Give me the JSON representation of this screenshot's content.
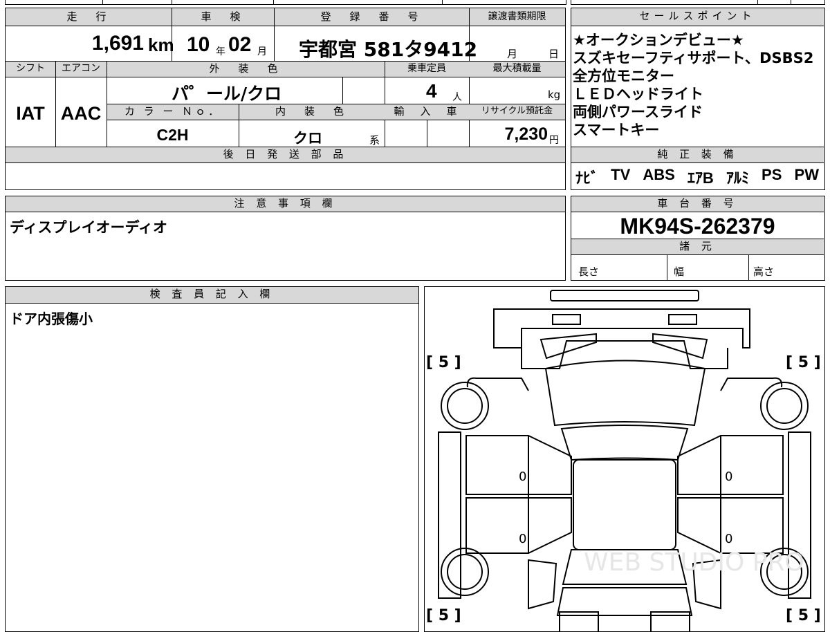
{
  "top_sheet": {
    "mileage": {
      "label": "走　行",
      "value": "1,691",
      "unit": "km"
    },
    "inspection": {
      "label": "車　検",
      "year": "10",
      "year_unit": "年",
      "month": "02",
      "month_unit": "月"
    },
    "registration": {
      "label": "登　録　番　号",
      "value": "宇都宮 581タ9412"
    },
    "transfer_deadline": {
      "label": "譲渡書類期限",
      "month_unit": "月",
      "day_unit": "日"
    },
    "shift": {
      "label": "シフト",
      "value": "IAT"
    },
    "aircon": {
      "label": "エアコン",
      "value": "AAC"
    },
    "exterior_color": {
      "label": "外　装　色",
      "value": "パ゜ール/クロ"
    },
    "capacity": {
      "label": "乗車定員",
      "value": "4",
      "unit": "人"
    },
    "max_load": {
      "label": "最大積載量",
      "unit": "kg"
    },
    "color_no": {
      "label": "カ ラ ー Ｎｏ．",
      "value": "C2H"
    },
    "interior_color": {
      "label": "内　装　色",
      "value": "クロ",
      "suffix": "系"
    },
    "import": {
      "label": "輸　入　車"
    },
    "recycle": {
      "label": "リサイクル預託金",
      "value": "7,230",
      "unit": "円"
    },
    "later_parts": {
      "label": "後 日 発 送 部 品"
    }
  },
  "sales_points": {
    "label": "セールスポイント",
    "lines": [
      "★オークションデビュー★",
      "スズキセーフティサポート、DSBS2",
      "全方位モニター",
      "ＬＥＤヘッドライト",
      "両側パワースライド",
      "スマートキー"
    ]
  },
  "genuine_equipment": {
    "label": "純 正 装 備",
    "items": [
      "ﾅﾋﾞ",
      "TV",
      "ABS",
      "ｴｱB",
      "ｱﾙﾐ",
      "PS",
      "PW"
    ]
  },
  "notes": {
    "label": "注 意 事 項 欄",
    "text": "ディスプレイオーディオ"
  },
  "chassis": {
    "label": "車 台 番 号",
    "value": "MK94S-262379"
  },
  "specs": {
    "label": "諸 元",
    "length": "長さ",
    "width": "幅",
    "height": "高さ"
  },
  "inspector": {
    "label": "検 査 員 記 入 欄",
    "text": "ドア内張傷小"
  },
  "diagram": {
    "tire_marks": [
      "[ 5 ]",
      "[ 5 ]",
      "[ 5 ]",
      "[ 5 ]"
    ],
    "door_marks": [
      "0",
      "0",
      "0",
      "0"
    ],
    "watermark": "WEB STUDIO PRO"
  }
}
